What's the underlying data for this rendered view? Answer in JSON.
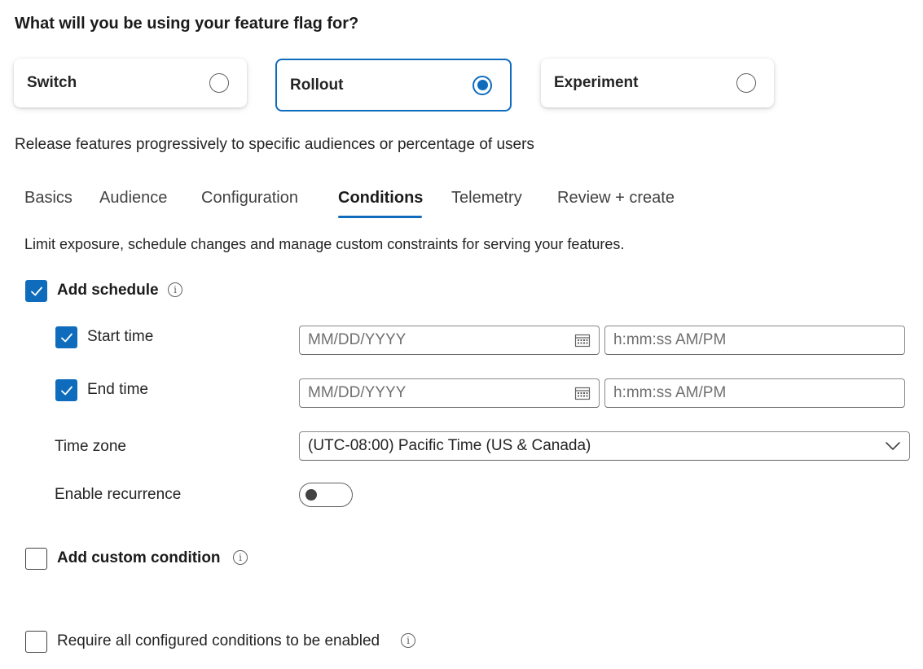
{
  "question": "What will you be using your feature flag for?",
  "cards": [
    {
      "label": "Switch",
      "selected": false
    },
    {
      "label": "Rollout",
      "selected": true
    },
    {
      "label": "Experiment",
      "selected": false
    }
  ],
  "description": "Release features progressively to specific audiences or percentage of users",
  "tabs": [
    {
      "label": "Basics"
    },
    {
      "label": "Audience"
    },
    {
      "label": "Configuration"
    },
    {
      "label": "Conditions",
      "active": true
    },
    {
      "label": "Telemetry"
    },
    {
      "label": "Review + create"
    }
  ],
  "conditions": {
    "description": "Limit exposure, schedule changes and manage custom constraints for serving your features.",
    "add_schedule": {
      "label": "Add schedule",
      "checked": true
    },
    "start_time": {
      "label": "Start time",
      "checked": true,
      "date_placeholder": "MM/DD/YYYY",
      "time_placeholder": "h:mm:ss AM/PM"
    },
    "end_time": {
      "label": "End time",
      "checked": true,
      "date_placeholder": "MM/DD/YYYY",
      "time_placeholder": "h:mm:ss AM/PM"
    },
    "time_zone": {
      "label": "Time zone",
      "value": "(UTC-08:00) Pacific Time (US & Canada)"
    },
    "recurrence": {
      "label": "Enable recurrence",
      "enabled": false
    },
    "add_custom_condition": {
      "label": "Add custom condition",
      "checked": false
    },
    "require_all": {
      "label": "Require all configured conditions to be enabled",
      "checked": false
    }
  },
  "icons": {
    "info": "info-icon",
    "calendar": "calendar-icon",
    "chevron": "chevron-down-icon",
    "check": "checkmark-icon"
  },
  "colors": {
    "accent": "#0f6cbd",
    "text": "#242424",
    "border": "#616161"
  }
}
